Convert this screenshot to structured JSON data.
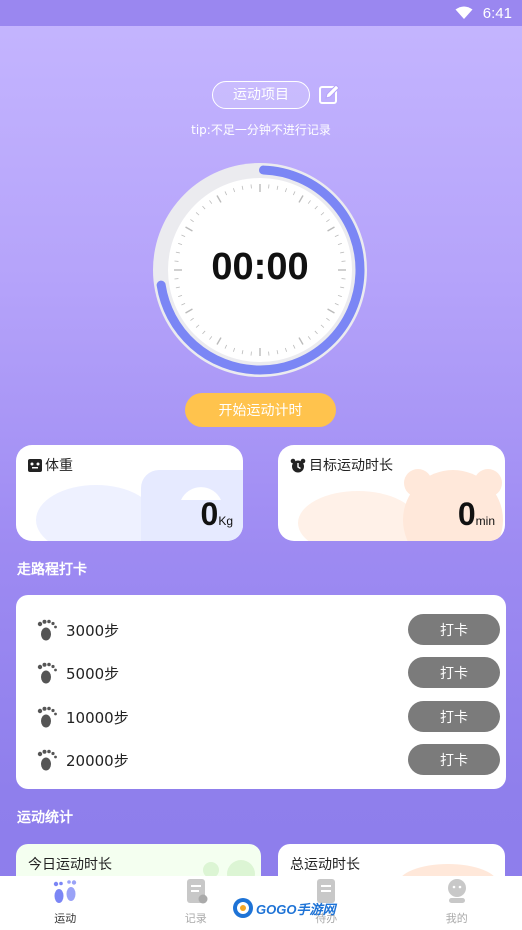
{
  "status_bar": {
    "time": "6:41"
  },
  "header": {
    "sport_item_label": "运动项目",
    "tip": "tip:不足一分钟不进行记录"
  },
  "timer": {
    "display": "00:00",
    "progress_fraction": 0.72
  },
  "start_button": "开始运动计时",
  "weight_card": {
    "title": "体重",
    "value": "0",
    "unit": "Kg"
  },
  "goal_card": {
    "title": "目标运动时长",
    "value": "0",
    "unit": "min"
  },
  "walk_section": {
    "title": "走路程打卡",
    "items": [
      {
        "label": "3000步",
        "button": "打卡"
      },
      {
        "label": "5000步",
        "button": "打卡"
      },
      {
        "label": "10000步",
        "button": "打卡"
      },
      {
        "label": "20000步",
        "button": "打卡"
      }
    ]
  },
  "stats_section": {
    "title": "运动统计",
    "today_label": "今日运动时长",
    "total_label": "总运动时长"
  },
  "tabbar": {
    "items": [
      {
        "label": "运动",
        "icon": "footprint-icon",
        "active": true
      },
      {
        "label": "记录",
        "icon": "record-icon",
        "active": false
      },
      {
        "label": "待办",
        "icon": "todo-icon",
        "active": false
      },
      {
        "label": "我的",
        "icon": "profile-icon",
        "active": false
      }
    ]
  },
  "watermark": {
    "text": "GOGO手游网"
  },
  "colors": {
    "accent": "#7b86f5",
    "start_button": "#ffc34d",
    "punch_button": "#7b7b7b"
  }
}
